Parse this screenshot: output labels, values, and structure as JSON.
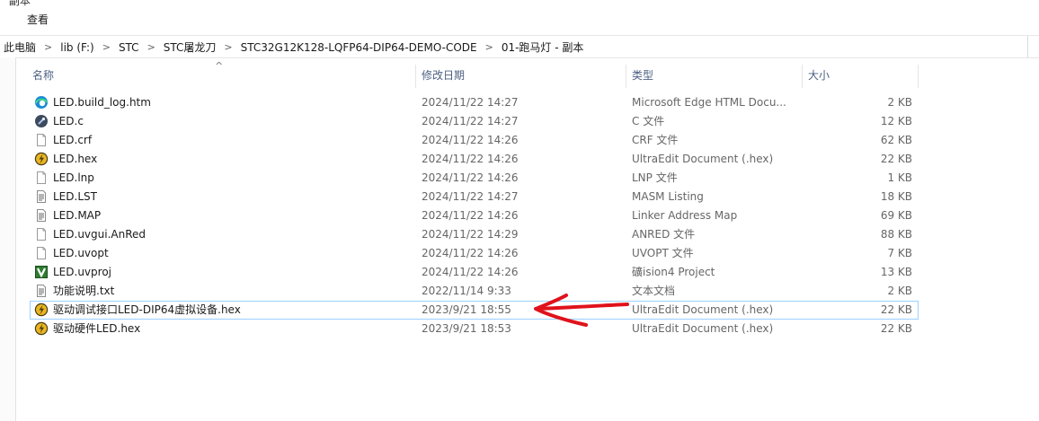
{
  "window": {
    "title_fragment": "ˇ 副本"
  },
  "ribbon": {
    "tab_view": "查看"
  },
  "address_bar": {
    "crumbs": [
      "此电脑",
      "lib (F:)",
      "STC",
      "STC屠龙刀",
      "STC32G12K128-LQFP64-DIP64-DEMO-CODE",
      "01-跑马灯 - 副本"
    ],
    "separator": ">"
  },
  "columns": {
    "name": "名称",
    "date": "修改日期",
    "type": "类型",
    "size": "大小",
    "sort_indicator": "^"
  },
  "files": [
    {
      "name": "LED.build_log.htm",
      "date": "2024/11/22 14:27",
      "type": "Microsoft Edge HTML Docu...",
      "size": "2 KB",
      "icon": "edge-icon"
    },
    {
      "name": "LED.c",
      "date": "2024/11/22 14:27",
      "type": "C 文件",
      "size": "12 KB",
      "icon": "c-file-icon"
    },
    {
      "name": "LED.crf",
      "date": "2024/11/22 14:26",
      "type": "CRF 文件",
      "size": "62 KB",
      "icon": "blank-file-icon"
    },
    {
      "name": "LED.hex",
      "date": "2024/11/22 14:26",
      "type": "UltraEdit Document (.hex)",
      "size": "22 KB",
      "icon": "ultraedit-icon"
    },
    {
      "name": "LED.lnp",
      "date": "2024/11/22 14:26",
      "type": "LNP 文件",
      "size": "1 KB",
      "icon": "blank-file-icon"
    },
    {
      "name": "LED.LST",
      "date": "2024/11/22 14:27",
      "type": "MASM Listing",
      "size": "18 KB",
      "icon": "text-file-icon"
    },
    {
      "name": "LED.MAP",
      "date": "2024/11/22 14:26",
      "type": "Linker Address Map",
      "size": "69 KB",
      "icon": "text-file-icon"
    },
    {
      "name": "LED.uvgui.AnRed",
      "date": "2024/11/22 14:29",
      "type": "ANRED 文件",
      "size": "88 KB",
      "icon": "blank-file-icon"
    },
    {
      "name": "LED.uvopt",
      "date": "2024/11/22 14:26",
      "type": "UVOPT 文件",
      "size": "7 KB",
      "icon": "blank-file-icon"
    },
    {
      "name": "LED.uvproj",
      "date": "2024/11/22 14:26",
      "type": "礦ision4 Project",
      "size": "13 KB",
      "icon": "keil-project-icon"
    },
    {
      "name": "功能说明.txt",
      "date": "2022/11/14 9:33",
      "type": "文本文档",
      "size": "2 KB",
      "icon": "text-file-icon"
    },
    {
      "name": "驱动调试接口LED-DIP64虚拟设备.hex",
      "date": "2023/9/21 18:55",
      "type": "UltraEdit Document (.hex)",
      "size": "22 KB",
      "icon": "ultraedit-icon",
      "selected": true
    },
    {
      "name": "驱动硬件LED.hex",
      "date": "2023/9/21 18:53",
      "type": "UltraEdit Document (.hex)",
      "size": "22 KB",
      "icon": "ultraedit-icon"
    }
  ],
  "colors": {
    "accent_border": "#99d1ff",
    "annotation_arrow": "#e0121b",
    "header_text": "#4d6082"
  }
}
